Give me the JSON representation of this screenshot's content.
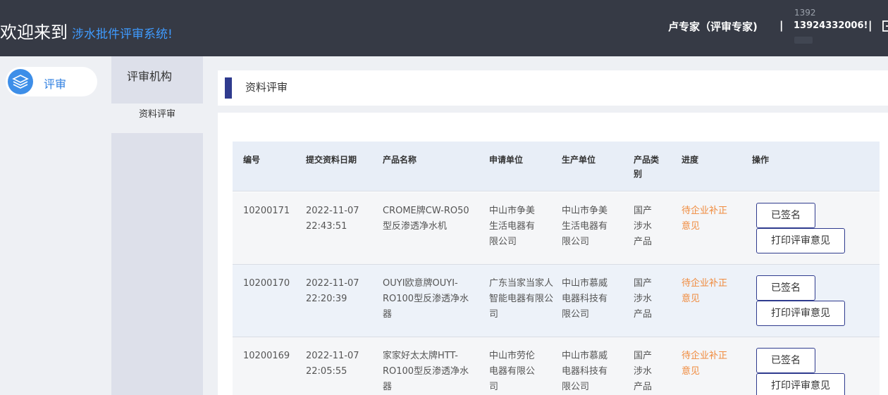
{
  "header": {
    "welcome": "欢迎来到",
    "system_name": "涉水批件评审系统!",
    "user": "卢专家（评审专家)",
    "separator": "|",
    "phone_top": "1392",
    "phone": "13924332006!"
  },
  "leftnav": {
    "items": [
      {
        "label": "评审",
        "icon": "layers-icon"
      }
    ]
  },
  "subnav": {
    "title": "评审机构",
    "items": [
      {
        "label": "资料评审"
      }
    ]
  },
  "page": {
    "title": "资料评审"
  },
  "table": {
    "columns": [
      "编号",
      "提交资料日期",
      "产品名称",
      "申请单位",
      "生产单位",
      "产品类别",
      "进度",
      "操作"
    ],
    "rows": [
      {
        "id": "10200171",
        "date": "2022-11-07",
        "time": "22:43:51",
        "product": "CROME牌CW-RO50型反渗透净水机",
        "applicant": "中山市争美生活电器有限公司",
        "manufacturer": "中山市争美生活电器有限公司",
        "category": "国产涉水产品",
        "status": "待企业补正意见",
        "sign_label": "已签名",
        "print_label": "打印评审意见"
      },
      {
        "id": "10200170",
        "date": "2022-11-07",
        "time": "22:20:39",
        "product": "OUYI欧意牌OUYI-RO100型反渗透净水器",
        "applicant": "广东当家当家人智能电器有限公司",
        "manufacturer": "中山市慕威电器科技有限公司",
        "category": "国产涉水产品",
        "status": "待企业补正意见",
        "sign_label": "已签名",
        "print_label": "打印评审意见"
      },
      {
        "id": "10200169",
        "date": "2022-11-07",
        "time": "22:05:55",
        "product": "家家好太太牌HTT-RO100型反渗透净水器",
        "applicant": "中山市劳伦电器有限公司",
        "manufacturer": "中山市慕威电器科技有限公司",
        "category": "国产涉水产品",
        "status": "待企业补正意见",
        "sign_label": "已签名",
        "print_label": "打印评审意见"
      }
    ]
  },
  "colors": {
    "header_bg": "#363a45",
    "accent_blue": "#3f9bff",
    "status_orange": "#f08a3c",
    "button_border": "#2f3b8e"
  }
}
